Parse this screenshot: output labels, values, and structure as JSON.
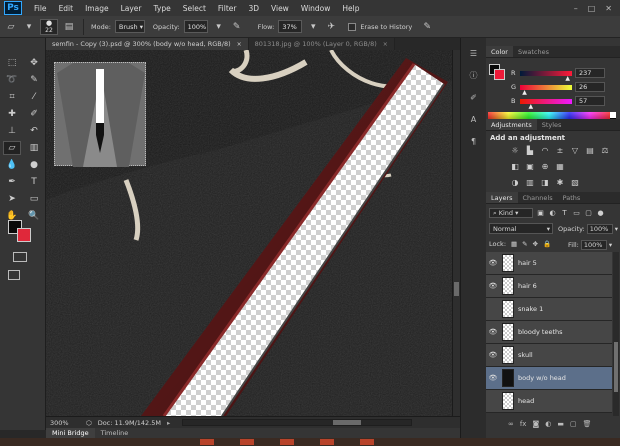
{
  "app": {
    "logo": "Ps"
  },
  "menu": [
    "File",
    "Edit",
    "Image",
    "Layer",
    "Type",
    "Select",
    "Filter",
    "3D",
    "View",
    "Window",
    "Help"
  ],
  "window_buttons": [
    "–",
    "□",
    "✕"
  ],
  "options": {
    "brush_size": "22",
    "mode_label": "Mode:",
    "mode_value": "Brush",
    "opacity_label": "Opacity:",
    "opacity_value": "100%",
    "flow_label": "Flow:",
    "flow_value": "37%",
    "erase_history_label": "Erase to History"
  },
  "tabs": [
    {
      "label": "semfin - Copy (3).psd @ 300% (body w/o head, RGB/8)",
      "close": "×",
      "active": true
    },
    {
      "label": "801318.jpg @ 100% (Layer 0, RGB/8)",
      "close": "×",
      "active": false
    }
  ],
  "status": {
    "zoom": "300%",
    "doc_size": "Doc: 11.9M/142.5M"
  },
  "bottom_tabs": [
    "Mini Bridge",
    "Timeline"
  ],
  "color_panel": {
    "tabs": [
      "Color",
      "Swatches"
    ],
    "channels": [
      {
        "label": "R",
        "value": "237",
        "gradient": "linear-gradient(to right,#001a39,#ff1a39)",
        "marker": 0.93
      },
      {
        "label": "G",
        "value": "26",
        "gradient": "linear-gradient(to right,#ed0039,#edff39)",
        "marker": 0.1
      },
      {
        "label": "B",
        "value": "57",
        "gradient": "linear-gradient(to right,#ed1a00,#ed1aff)",
        "marker": 0.22
      }
    ],
    "fg_color": "#0a0a0a",
    "bg_color": "#ed1a39"
  },
  "adjustments": {
    "tabs": [
      "Adjustments",
      "Styles"
    ],
    "title": "Add an adjustment",
    "icons": [
      "brightness-contrast-icon",
      "levels-icon",
      "curves-icon",
      "exposure-icon",
      "vibrance-icon",
      "hue-saturation-icon",
      "color-balance-icon",
      "black-white-icon",
      "photo-filter-icon",
      "channel-mixer-icon",
      "color-lookup-icon",
      "invert-icon",
      "posterize-icon",
      "threshold-icon",
      "selective-color-icon",
      "gradient-map-icon"
    ]
  },
  "layers_panel": {
    "tabs": [
      "Layers",
      "Channels",
      "Paths"
    ],
    "kind_label": "Kind",
    "blend_mode": "Normal",
    "opacity_label": "Opacity:",
    "opacity_value": "100%",
    "lock_label": "Lock:",
    "fill_label": "Fill:",
    "fill_value": "100%",
    "layers": [
      {
        "name": "hair 5",
        "visible": true,
        "selected": false,
        "thumb": "transparent"
      },
      {
        "name": "hair 6",
        "visible": true,
        "selected": false,
        "thumb": "transparent"
      },
      {
        "name": "snake 1",
        "visible": false,
        "selected": false,
        "thumb": "transparent"
      },
      {
        "name": "bloody teeths",
        "visible": true,
        "selected": false,
        "thumb": "transparent"
      },
      {
        "name": "skull",
        "visible": true,
        "selected": false,
        "thumb": "transparent"
      },
      {
        "name": "body w/o head",
        "visible": true,
        "selected": true,
        "thumb": "body"
      },
      {
        "name": "head",
        "visible": false,
        "selected": false,
        "thumb": "transparent"
      }
    ]
  }
}
